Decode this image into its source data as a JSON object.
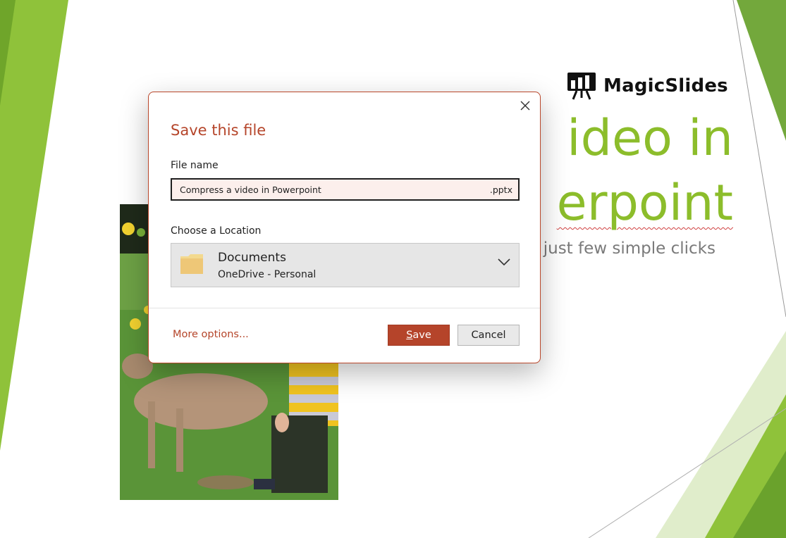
{
  "slide": {
    "brand_name": "MagicSlides",
    "title_line1": "ideo in",
    "title_line2": "erpoint",
    "subtitle": "just few simple clicks",
    "accent_color": "#8cbd2b"
  },
  "dialog": {
    "title": "Save this file",
    "file_name_label": "File name",
    "file_name_value": "Compress a video in Powerpoint",
    "file_extension": ".pptx",
    "location_label": "Choose a Location",
    "location_name": "Documents",
    "location_sub": "OneDrive - Personal",
    "more_options": "More options...",
    "save_accesskey": "S",
    "save_rest": "ave",
    "cancel_label": "Cancel",
    "accent_color": "#b5452a"
  },
  "icons": {
    "close": "close-icon",
    "folder": "folder-icon",
    "chevron": "chevron-down-icon",
    "brand": "presentation-board-icon"
  }
}
